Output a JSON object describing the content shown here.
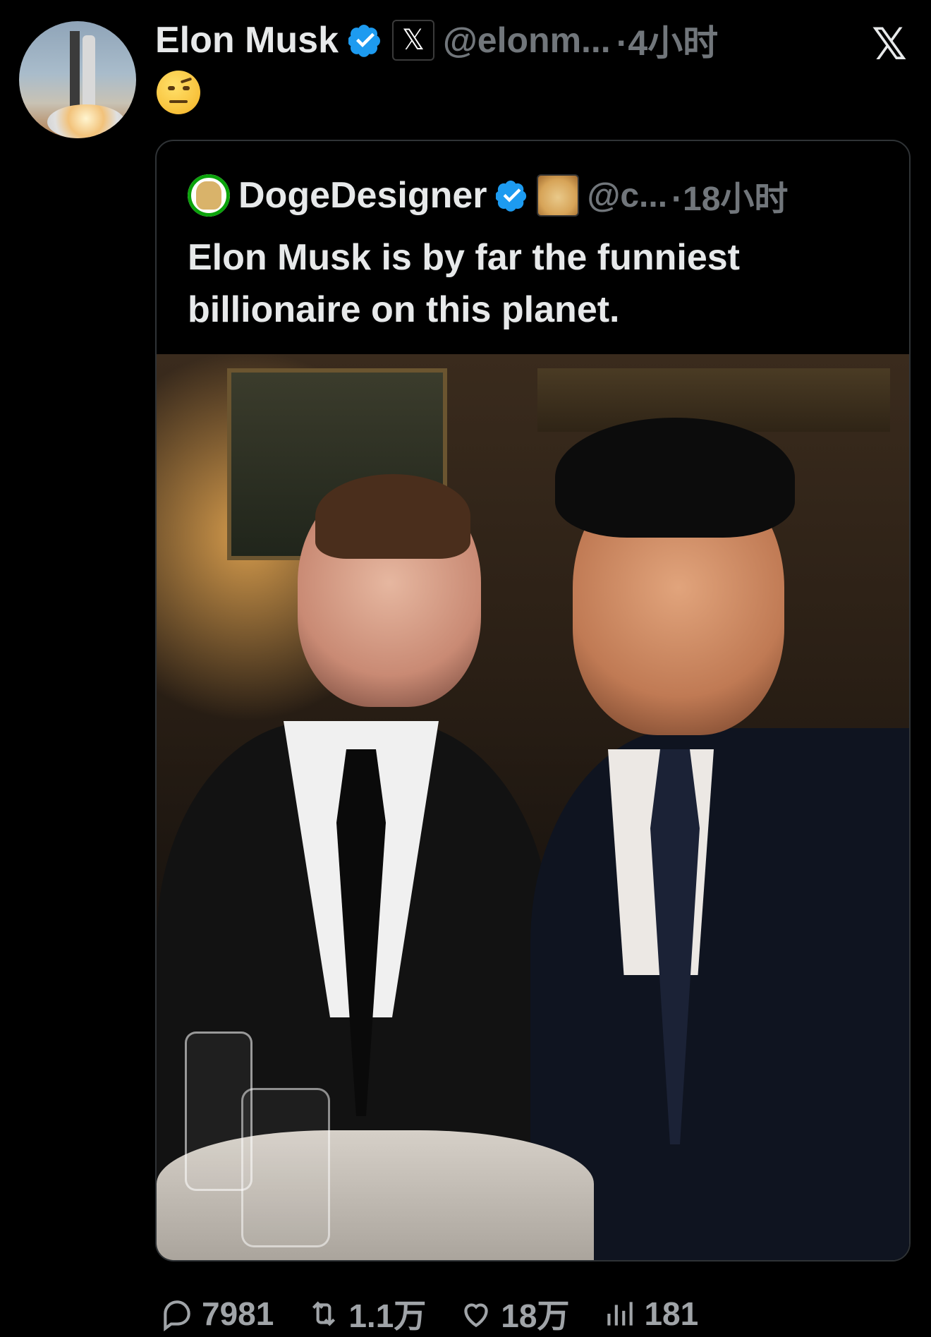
{
  "tweet": {
    "author_name": "Elon Musk",
    "handle": "@elonm...",
    "time": "·4小时",
    "emoji": "🤨"
  },
  "quote": {
    "author_name": "DogeDesigner",
    "handle": "@c...",
    "time": "·18小时",
    "text_lines": [
      "Elon Musk is by far the funniest",
      "billionaire on this planet."
    ]
  },
  "actions": {
    "replies": "7981",
    "reposts": "1.1万",
    "likes": "18万",
    "views": "181"
  },
  "colors": {
    "background": "#000000",
    "verified_blue": "#1d9bf0",
    "muted_text": "#71767b",
    "primary_text": "#e7e9ea"
  }
}
